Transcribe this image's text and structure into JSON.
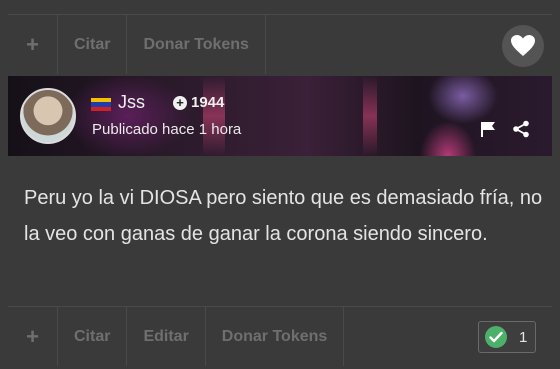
{
  "top_bar": {
    "plus_label": "+",
    "quote_label": "Citar",
    "donate_label": "Donar Tokens",
    "heart_icon": "heart-icon"
  },
  "post": {
    "author": "Jss",
    "country_flag": "venezuela-flag",
    "points": "1944",
    "published": "Publicado hace 1 hora",
    "text": "Peru yo la vi DIOSA pero siento que es demasiado fría, no la veo con ganas de ganar la corona siendo sincero."
  },
  "bottom_bar": {
    "plus_label": "+",
    "quote_label": "Citar",
    "edit_label": "Editar",
    "donate_label": "Donar Tokens",
    "vote_count": "1"
  },
  "colors": {
    "background": "#3a3a3a",
    "vote_check": "#4caf6a"
  }
}
